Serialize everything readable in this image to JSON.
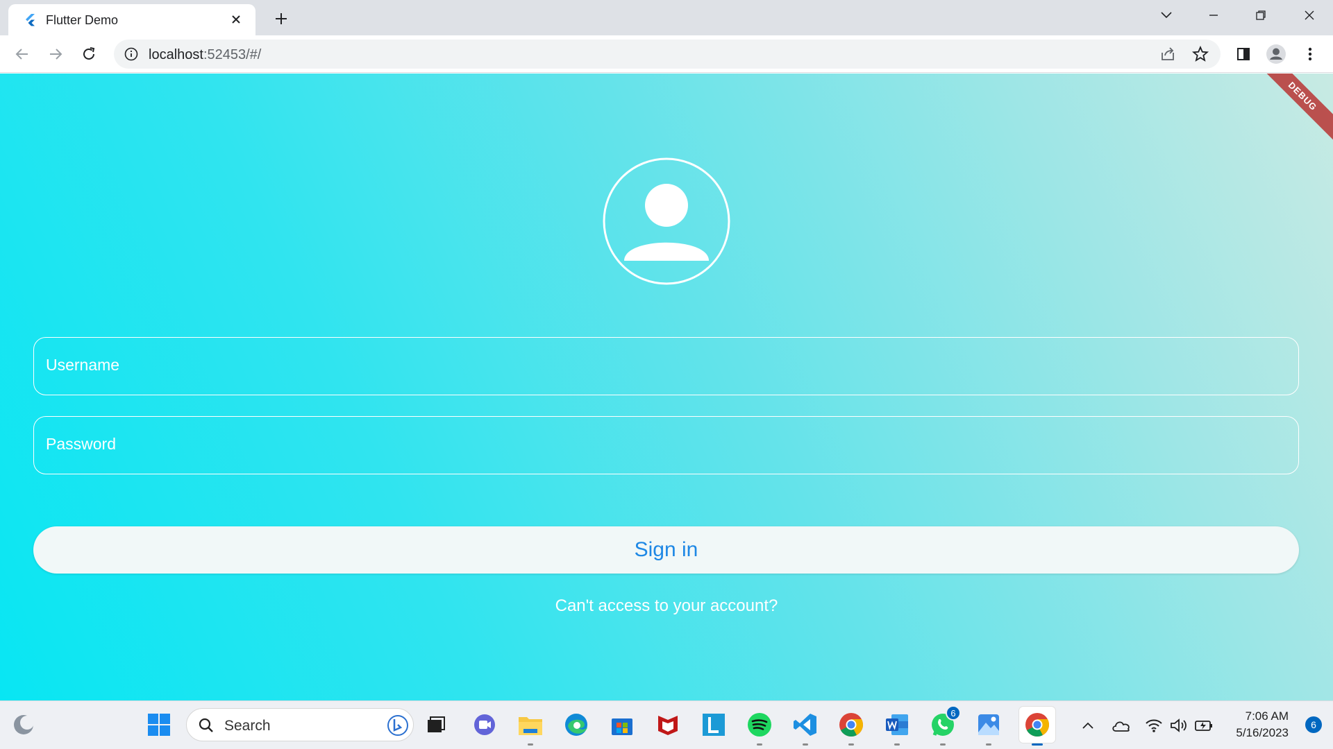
{
  "browser": {
    "tab_title": "Flutter Demo",
    "url_host": "localhost",
    "url_rest": ":52453/#/"
  },
  "app": {
    "debug_banner": "DEBUG",
    "username_label": "Username",
    "password_label": "Password",
    "signin_label": "Sign in",
    "forgot_label": "Can't access to your account?"
  },
  "taskbar": {
    "search_placeholder": "Search",
    "whatsapp_badge": "6",
    "time": "7:06 AM",
    "date": "5/16/2023",
    "notification_count": "6"
  },
  "colors": {
    "accent": "#1e88e5",
    "gradient_start": "#08e6f3",
    "gradient_end": "#c8eae3",
    "debug_banner": "#b71c1c"
  }
}
